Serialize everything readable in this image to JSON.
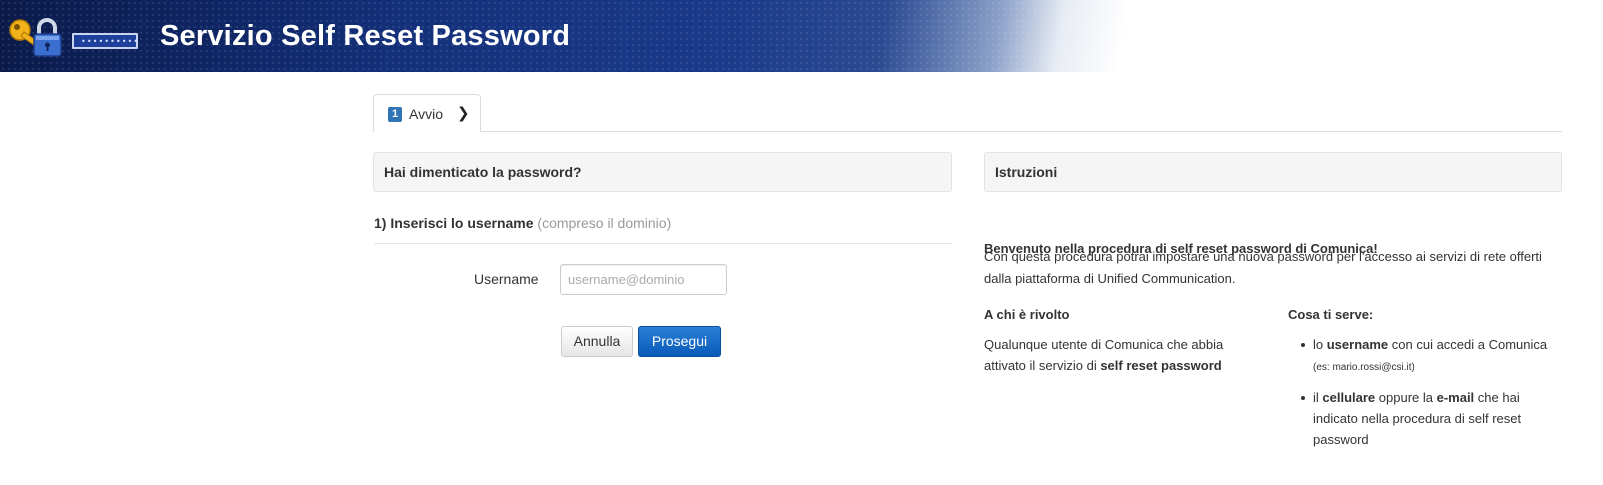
{
  "header": {
    "title": "Servizio Self Reset Password",
    "password_dots": "••••••••••",
    "brand_color": "#14307a"
  },
  "tabs": [
    {
      "number": "1",
      "label": "Avvio",
      "chevron": "❯"
    }
  ],
  "form_panel": {
    "heading": "Hai dimenticato la password?",
    "step_title": "1) Inserisci lo username",
    "step_hint": "(compreso il dominio)",
    "username_label": "Username",
    "username_placeholder": "username@dominio",
    "username_value": "",
    "cancel_label": "Annulla",
    "next_label": "Prosegui"
  },
  "instructions_panel": {
    "heading": "Istruzioni",
    "welcome": "Benvenuto nella procedura di self reset password di Comunica!",
    "intro": "Con questa procedura potrai impostare una nuova password per l'accesso ai servizi di rete offerti dalla piattaforma di Unified Communication.",
    "who_heading": "A chi è rivolto",
    "who_text_before": "Qualunque utente di Comunica che abbia attivato il servizio di ",
    "who_text_bold": "self reset password",
    "needs_heading": "Cosa ti serve:",
    "needs": [
      {
        "pre": "lo ",
        "bold": "username",
        "post": " con cui accedi a Comunica ",
        "small": "(es: mario.rossi@csi.it)"
      },
      {
        "pre": "il ",
        "bold": "cellulare",
        "mid": " oppure la ",
        "bold2": "e-mail",
        "post": " che hai indicato nella procedura di self reset password"
      }
    ]
  }
}
